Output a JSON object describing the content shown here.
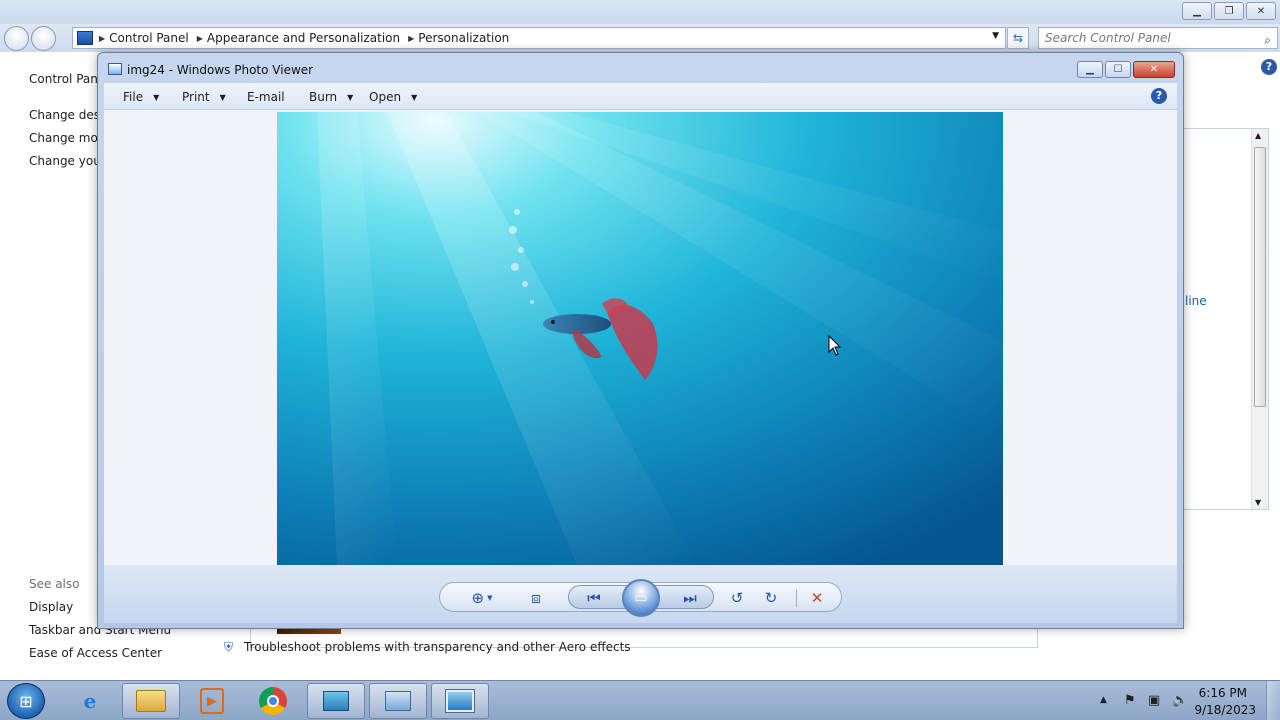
{
  "control_panel": {
    "breadcrumbs": [
      "Control Panel",
      "Appearance and Personalization",
      "Personalization"
    ],
    "search_placeholder": "Search Control Panel",
    "left_nav": {
      "home": "Control Panel",
      "links": [
        "Change desk",
        "Change mou",
        "Change your"
      ],
      "see_also_label": "See also",
      "see_also": [
        "Display",
        "Taskbar and Start Menu",
        "Ease of Access Center"
      ]
    },
    "right_link_fragment": "line",
    "trouble_text": "Troubleshoot problems with transparency and other Aero effects"
  },
  "photo_viewer": {
    "title": "img24 - Windows Photo Viewer",
    "menu": {
      "file": "File",
      "print": "Print",
      "email": "E-mail",
      "burn": "Burn",
      "open": "Open"
    }
  },
  "taskbar": {
    "time": "6:16 PM",
    "date": "9/18/2023"
  },
  "colors": {
    "link": "#1a5fb4",
    "accent": "#2b5ba8",
    "close_red": "#c7442c"
  },
  "icons": {
    "zoom": "magnifier-plus-icon",
    "fit": "actual-size-icon",
    "prev": "previous-icon",
    "slideshow": "slideshow-icon",
    "next": "next-icon",
    "rotate_ccw": "rotate-counterclockwise-icon",
    "rotate_cw": "rotate-clockwise-icon",
    "delete": "delete-x-icon"
  }
}
